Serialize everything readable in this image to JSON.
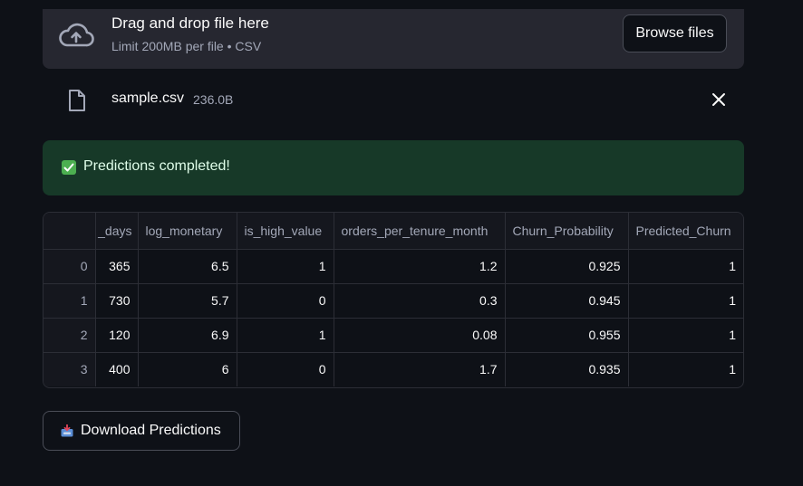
{
  "uploader": {
    "title": "Drag and drop file here",
    "subtitle": "Limit 200MB per file • CSV",
    "browse_label": "Browse files",
    "icon": "cloud-upload-icon"
  },
  "file": {
    "name": "sample.csv",
    "size": "236.0B",
    "icon": "file-icon",
    "remove_icon": "close-icon"
  },
  "status": {
    "message": "Predictions completed!",
    "icon": "check-box-icon",
    "color": "#173928"
  },
  "table": {
    "columns": [
      "_days",
      "log_monetary",
      "is_high_value",
      "orders_per_tenure_month",
      "Churn_Probability",
      "Predicted_Churn"
    ],
    "rows": [
      {
        "index": "0",
        "cells": [
          "365",
          "6.5",
          "1",
          "1.2",
          "0.925",
          "1"
        ]
      },
      {
        "index": "1",
        "cells": [
          "730",
          "5.7",
          "0",
          "0.3",
          "0.945",
          "1"
        ]
      },
      {
        "index": "2",
        "cells": [
          "120",
          "6.9",
          "1",
          "0.08",
          "0.955",
          "1"
        ]
      },
      {
        "index": "3",
        "cells": [
          "400",
          "6",
          "0",
          "1.7",
          "0.935",
          "1"
        ]
      }
    ]
  },
  "download": {
    "label": "Download Predictions",
    "icon": "inbox-tray-icon"
  }
}
